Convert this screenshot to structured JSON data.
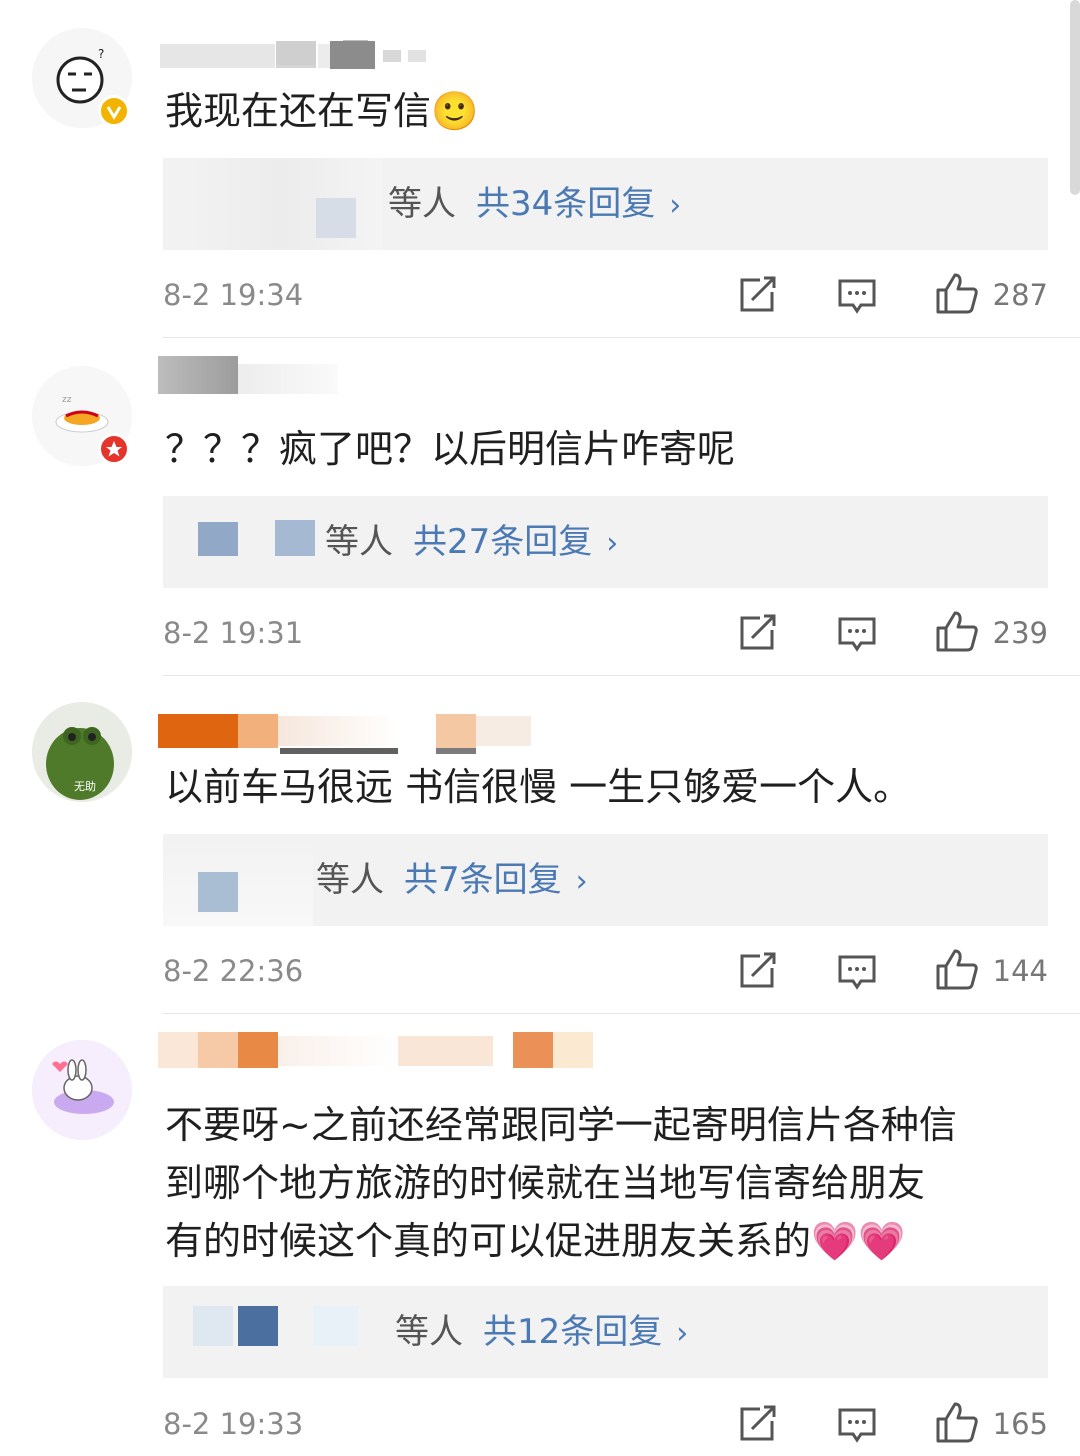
{
  "comments": [
    {
      "text": "我现在还在写信🙂",
      "reply": {
        "who": "等人",
        "count": "共34条回复",
        "chevron": "›"
      },
      "time": "8-2 19:34",
      "likes": "287",
      "badge_color": "#f2b400"
    },
    {
      "text": "？？？疯了吧？以后明信片咋寄呢",
      "reply": {
        "who": "等人",
        "count": "共27条回复",
        "chevron": "›"
      },
      "time": "8-2 19:31",
      "likes": "239",
      "badge_color": "#e5352b"
    },
    {
      "text": "以前车马很远 书信很慢 一生只够爱一个人。",
      "avatar_label": "无助",
      "reply": {
        "who": "等人",
        "count": "共7条回复",
        "chevron": "›"
      },
      "time": "8-2 22:36",
      "likes": "144"
    },
    {
      "text_lines": [
        "不要呀~之前还经常跟同学一起寄明信片各种信",
        "到哪个地方旅游的时候就在当地写信寄给朋友",
        "有的时候这个真的可以促进朋友关系的💗💗"
      ],
      "reply": {
        "who": "等人",
        "count": "共12条回复",
        "chevron": "›"
      },
      "time": "8-2 19:33",
      "likes": "165"
    }
  ],
  "icons": {
    "share": "share-icon",
    "comment": "comment-icon",
    "like": "thumbs-up-icon"
  },
  "colors": {
    "link_blue": "#4a79b3",
    "reply_bg": "#f2f2f2"
  }
}
